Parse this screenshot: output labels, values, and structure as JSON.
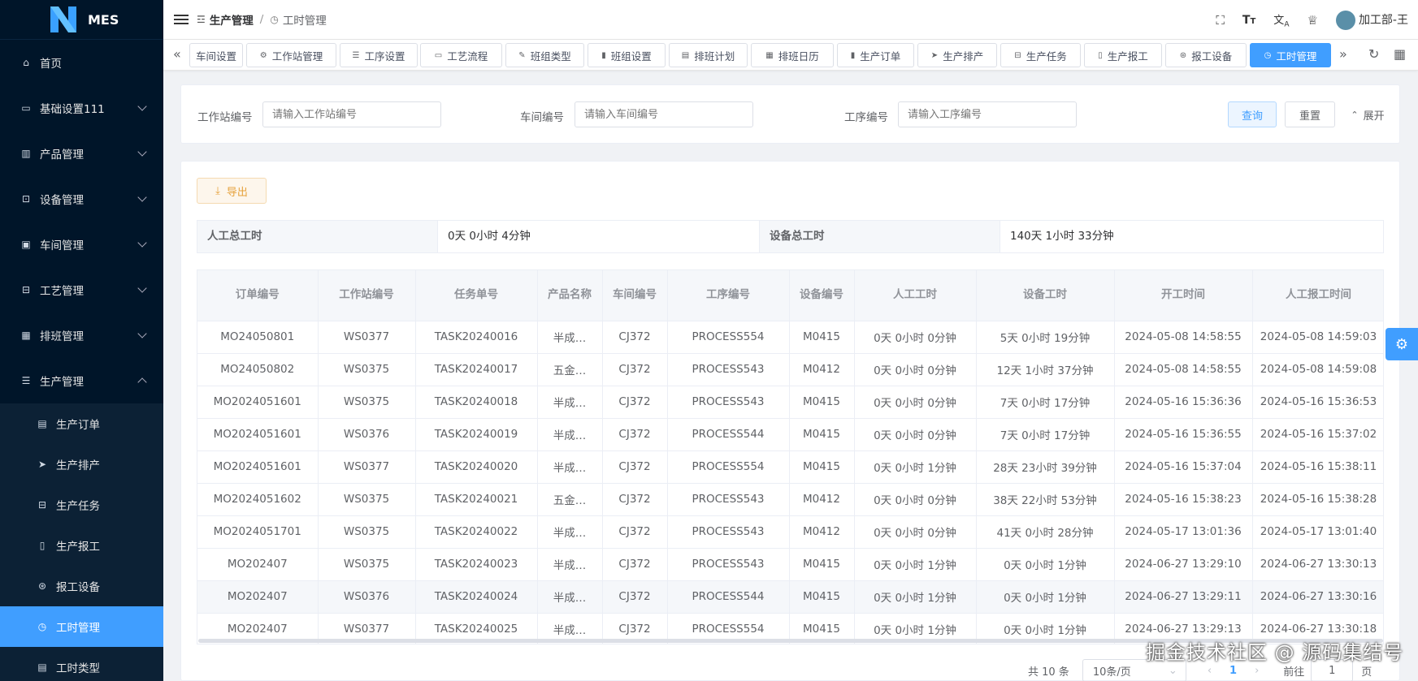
{
  "app": {
    "name": "MES"
  },
  "sidebar": {
    "items": [
      {
        "label": "首页",
        "icon": "home-icon"
      },
      {
        "label": "基础设置111",
        "icon": "monitor-icon"
      },
      {
        "label": "产品管理",
        "icon": "chart-icon"
      },
      {
        "label": "设备管理",
        "icon": "cpu-icon"
      },
      {
        "label": "车间管理",
        "icon": "car-icon"
      },
      {
        "label": "工艺管理",
        "icon": "briefcase-icon"
      },
      {
        "label": "排班管理",
        "icon": "calendar-icon"
      },
      {
        "label": "生产管理",
        "icon": "database-icon"
      }
    ],
    "sub_items": [
      {
        "label": "生产订单",
        "icon": "clipboard-icon"
      },
      {
        "label": "生产排产",
        "icon": "send-icon"
      },
      {
        "label": "生产任务",
        "icon": "briefcase-icon"
      },
      {
        "label": "生产报工",
        "icon": "phone-icon"
      },
      {
        "label": "报工设备",
        "icon": "settings-icon"
      },
      {
        "label": "工时管理",
        "icon": "clock-icon"
      },
      {
        "label": "工时类型",
        "icon": "document-icon"
      }
    ]
  },
  "header": {
    "breadcrumb": [
      "生产管理",
      "工时管理"
    ],
    "user": "加工部-王"
  },
  "tabs": [
    "车间设置",
    "工作站管理",
    "工序设置",
    "工艺流程",
    "班组类型",
    "班组设置",
    "排班计划",
    "排班日历",
    "生产订单",
    "生产排产",
    "生产任务",
    "生产报工",
    "报工设备",
    "工时管理"
  ],
  "search": {
    "fields": [
      {
        "label": "工作站编号",
        "placeholder": "请输入工作站编号"
      },
      {
        "label": "车间编号",
        "placeholder": "请输入车间编号"
      },
      {
        "label": "工序编号",
        "placeholder": "请输入工序编号"
      }
    ],
    "query_label": "查询",
    "reset_label": "重置",
    "expand_label": "展开"
  },
  "toolbar": {
    "export_label": "导出"
  },
  "summary": {
    "labor_label": "人工总工时",
    "labor_value": "0天 0小时 4分钟",
    "device_label": "设备总工时",
    "device_value": "140天 1小时 33分钟"
  },
  "table": {
    "columns": [
      "订单编号",
      "工作站编号",
      "任务单号",
      "产品名称",
      "车间编号",
      "工序编号",
      "设备编号",
      "人工工时",
      "设备工时",
      "开工时间",
      "人工报工时间"
    ],
    "rows": [
      [
        "MO24050801",
        "WS0377",
        "TASK20240016",
        "半成…",
        "CJ372",
        "PROCESS554",
        "M0415",
        "0天 0小时 0分钟",
        "5天 0小时 19分钟",
        "2024-05-08 14:58:55",
        "2024-05-08 14:59:03"
      ],
      [
        "MO24050802",
        "WS0375",
        "TASK20240017",
        "五金…",
        "CJ372",
        "PROCESS543",
        "M0412",
        "0天 0小时 0分钟",
        "12天 1小时 37分钟",
        "2024-05-08 14:58:55",
        "2024-05-08 14:59:08"
      ],
      [
        "MO2024051601",
        "WS0375",
        "TASK20240018",
        "半成…",
        "CJ372",
        "PROCESS543",
        "M0415",
        "0天 0小时 0分钟",
        "7天 0小时 17分钟",
        "2024-05-16 15:36:36",
        "2024-05-16 15:36:53"
      ],
      [
        "MO2024051601",
        "WS0376",
        "TASK20240019",
        "半成…",
        "CJ372",
        "PROCESS544",
        "M0415",
        "0天 0小时 0分钟",
        "7天 0小时 17分钟",
        "2024-05-16 15:36:55",
        "2024-05-16 15:37:02"
      ],
      [
        "MO2024051601",
        "WS0377",
        "TASK20240020",
        "半成…",
        "CJ372",
        "PROCESS554",
        "M0415",
        "0天 0小时 1分钟",
        "28天 23小时 39分钟",
        "2024-05-16 15:37:04",
        "2024-05-16 15:38:11"
      ],
      [
        "MO2024051602",
        "WS0375",
        "TASK20240021",
        "五金…",
        "CJ372",
        "PROCESS543",
        "M0412",
        "0天 0小时 0分钟",
        "38天 22小时 53分钟",
        "2024-05-16 15:38:23",
        "2024-05-16 15:38:28"
      ],
      [
        "MO2024051701",
        "WS0375",
        "TASK20240022",
        "半成…",
        "CJ372",
        "PROCESS543",
        "M0412",
        "0天 0小时 0分钟",
        "41天 0小时 28分钟",
        "2024-05-17 13:01:36",
        "2024-05-17 13:01:40"
      ],
      [
        "MO202407",
        "WS0375",
        "TASK20240023",
        "半成…",
        "CJ372",
        "PROCESS543",
        "M0415",
        "0天 0小时 1分钟",
        "0天 0小时 1分钟",
        "2024-06-27 13:29:10",
        "2024-06-27 13:30:13"
      ],
      [
        "MO202407",
        "WS0376",
        "TASK20240024",
        "半成…",
        "CJ372",
        "PROCESS544",
        "M0415",
        "0天 0小时 1分钟",
        "0天 0小时 1分钟",
        "2024-06-27 13:29:11",
        "2024-06-27 13:30:16"
      ],
      [
        "MO202407",
        "WS0377",
        "TASK20240025",
        "半成…",
        "CJ372",
        "PROCESS554",
        "M0415",
        "0天 0小时 1分钟",
        "0天 0小时 1分钟",
        "2024-06-27 13:29:13",
        "2024-06-27 13:30:18"
      ]
    ]
  },
  "pagination": {
    "total_text": "共 10 条",
    "page_size": "10条/页",
    "current_page": "1",
    "goto_label": "前往",
    "goto_value": "1",
    "page_suffix": "页"
  },
  "watermark": "掘金技术社区 @ 源码集结号",
  "colors": {
    "primary": "#409eff",
    "sidebar_bg": "#001529",
    "warning": "#e6a23c"
  }
}
